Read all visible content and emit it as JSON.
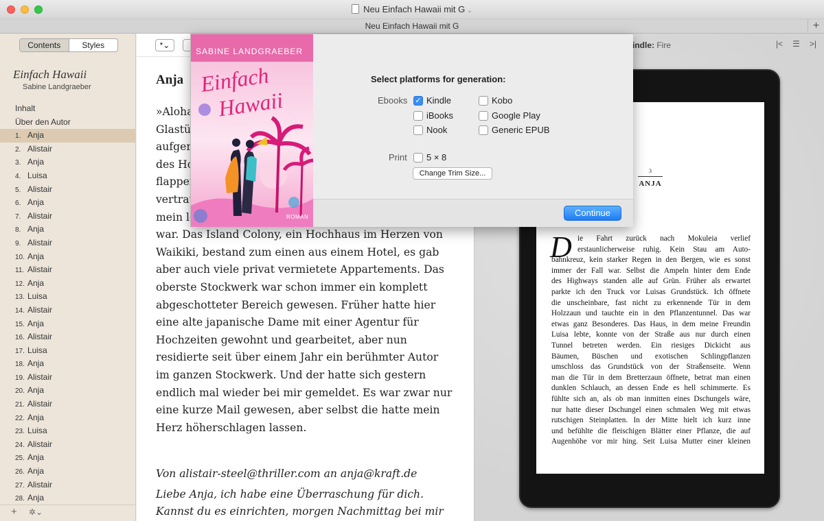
{
  "window": {
    "title": "Neu Einfach Hawaii mit G",
    "tab_title": "Neu Einfach Hawaii mit G"
  },
  "sidebar": {
    "tabs": [
      {
        "label": "Contents",
        "active": true
      },
      {
        "label": "Styles",
        "active": false
      }
    ],
    "book_title": "Einfach Hawaii",
    "book_author": "Sabine Landgraeber",
    "items": [
      {
        "num": "",
        "label": "Inhalt"
      },
      {
        "num": "",
        "label": "Über den Autor"
      },
      {
        "num": "1.",
        "label": "Anja",
        "selected": true
      },
      {
        "num": "2.",
        "label": "Alistair"
      },
      {
        "num": "3.",
        "label": "Anja"
      },
      {
        "num": "4.",
        "label": "Luisa"
      },
      {
        "num": "5.",
        "label": "Alistair"
      },
      {
        "num": "6.",
        "label": "Anja"
      },
      {
        "num": "7.",
        "label": "Alistair"
      },
      {
        "num": "8.",
        "label": "Anja"
      },
      {
        "num": "9.",
        "label": "Alistair"
      },
      {
        "num": "10.",
        "label": "Anja"
      },
      {
        "num": "11.",
        "label": "Alistair"
      },
      {
        "num": "12.",
        "label": "Anja"
      },
      {
        "num": "13.",
        "label": "Luisa"
      },
      {
        "num": "14.",
        "label": "Alistair"
      },
      {
        "num": "15.",
        "label": "Anja"
      },
      {
        "num": "16.",
        "label": "Alistair"
      },
      {
        "num": "17.",
        "label": "Luisa"
      },
      {
        "num": "18.",
        "label": "Anja"
      },
      {
        "num": "19.",
        "label": "Alistair"
      },
      {
        "num": "20.",
        "label": "Anja"
      },
      {
        "num": "21.",
        "label": "Alistair"
      },
      {
        "num": "22.",
        "label": "Anja"
      },
      {
        "num": "23.",
        "label": "Luisa"
      },
      {
        "num": "24.",
        "label": "Alistair"
      },
      {
        "num": "25.",
        "label": "Anja"
      },
      {
        "num": "26.",
        "label": "Anja"
      },
      {
        "num": "27.",
        "label": "Alistair"
      },
      {
        "num": "28.",
        "label": "Anja"
      }
    ],
    "footer": {
      "add": "+",
      "gear": "✲⌄"
    }
  },
  "editor": {
    "style_button": "*⌄",
    "chapter_heading": "Anja",
    "prose_lines": [
      "»Aloha",
      "Glastür",
      "aufgere",
      "des Ho",
      "flapper",
      "vertrau",
      "mein le",
      "war. Das Island Colony, ein Hochhaus im Herzen von",
      "Waikiki, bestand zum einen aus einem Hotel, es gab",
      "aber auch viele privat vermietete Appartements. Das",
      "oberste Stockwerk war schon immer ein komplett",
      "abgeschotteter Bereich gewesen. Früher hatte hier",
      "eine alte japanische Dame mit einer Agentur für",
      "Hochzeiten gewohnt und gearbeitet, aber nun",
      "residierte seit über einem Jahr ein berühmter Autor",
      "im ganzen Stockwerk. Und der hatte sich gestern",
      "endlich mal wieder bei mir gemeldet. Es war zwar nur",
      "eine kurze Mail gewesen, aber selbst die hatte mein",
      "Herz höherschlagen lassen."
    ],
    "email_header": "Von alistair-steel@thriller.com an anja@kraft.de",
    "email_lines": [
      "Liebe Anja, ich habe eine Überraschung für dich.",
      "Kannst du es einrichten, morgen Nachmittag bei mir"
    ]
  },
  "preview": {
    "device_prefix": "indle:",
    "device_name": "Fire",
    "page_number": "3",
    "chapter": "ANJA",
    "dropcap": "D",
    "text_lines": [
      "ie Fahrt zurück nach Mokuleia verlief",
      "erstaunlicherweise ruhig. Kein Stau am Auto-",
      "bahnkreuz, kein starker Regen in den Bergen, wie es sonst",
      "immer der Fall war. Selbst die Ampeln hinter dem Ende",
      "des Highways standen alle auf Grün. Früher als erwartet",
      "parkte ich den Truck vor Luisas Grundstück. Ich öffnete",
      "die unscheinbare, fast nicht zu erkennende Tür in dem",
      "Holzzaun und tauchte ein in den Pflanzentunnel. Das war",
      "etwas ganz Besonderes. Das Haus, in dem meine Freundin",
      "Luisa lebte, konnte von der Straße aus nur durch einen",
      "Tunnel betreten werden. Ein riesiges Dickicht aus",
      "Bäumen, Büschen und exotischen Schlingpflanzen",
      "umschloss das Grundstück von der Straßenseite. Wenn",
      "man die Tür in dem Bretterzaun öffnete, betrat man einen",
      "dunklen Schlauch, an dessen Ende es hell schimmerte. Es",
      "fühlte sich an, als ob man inmitten eines Dschungels wäre,",
      "nur hatte dieser Dschungel einen schmalen Weg mit etwas",
      "rutschigen Steinplatten. In der Mitte hielt ich kurz inne",
      "und befühlte die fleischigen Blätter einer Pflanze, die auf",
      "Augenhöhe vor mir hing. Seit Luisa Mutter einer kleinen"
    ]
  },
  "dialog": {
    "cover": {
      "author": "SABINE LANDGRAEBER",
      "title_line1": "Einfach",
      "title_line2": "Hawaii",
      "genre": "ROMAN"
    },
    "heading": "Select platforms for generation:",
    "ebooks_label": "Ebooks",
    "print_label": "Print",
    "platforms": {
      "kindle": {
        "label": "Kindle",
        "checked": true
      },
      "kobo": {
        "label": "Kobo",
        "checked": false
      },
      "ibooks": {
        "label": "iBooks",
        "checked": false
      },
      "google_play": {
        "label": "Google Play",
        "checked": false
      },
      "nook": {
        "label": "Nook",
        "checked": false
      },
      "generic_epub": {
        "label": "Generic EPUB",
        "checked": false
      },
      "print_5x8": {
        "label": "5 × 8",
        "checked": false
      }
    },
    "change_trim_label": "Change Trim Size...",
    "continue_label": "Continue",
    "check_mark": "✓"
  },
  "colors": {
    "accent": "#3b8ef3",
    "sidebar_bg": "#ede5da",
    "sidebar_selected": "#dccbb2",
    "cover_pink": "#f5a5cf",
    "cover_title": "#e2237a"
  }
}
